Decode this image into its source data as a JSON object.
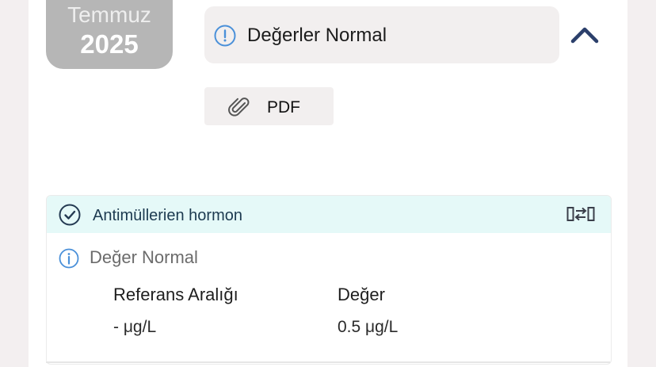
{
  "date_badge": {
    "month": "Temmuz",
    "year": "2025"
  },
  "status_pill": {
    "text": "Değerler Normal"
  },
  "pdf_button": {
    "label": "PDF"
  },
  "test_result": {
    "name": "Antimüllerien hormon",
    "status": "Değer Normal",
    "columns": [
      "Referans Aralığı",
      "Değer"
    ],
    "values": [
      "- μg/L",
      "0.5 μg/L"
    ]
  },
  "colors": {
    "accent_navy": "#2b3f6b",
    "info_blue": "#4a90d9",
    "header_teal": "#e5f9f8",
    "badge_gray": "#b6b6b6"
  },
  "icons": {
    "status": "info-circle-icon",
    "collapse": "chevron-up-icon",
    "attachment": "paperclip-icon",
    "verified": "check-circle-icon",
    "compare": "compare-arrows-icon"
  }
}
